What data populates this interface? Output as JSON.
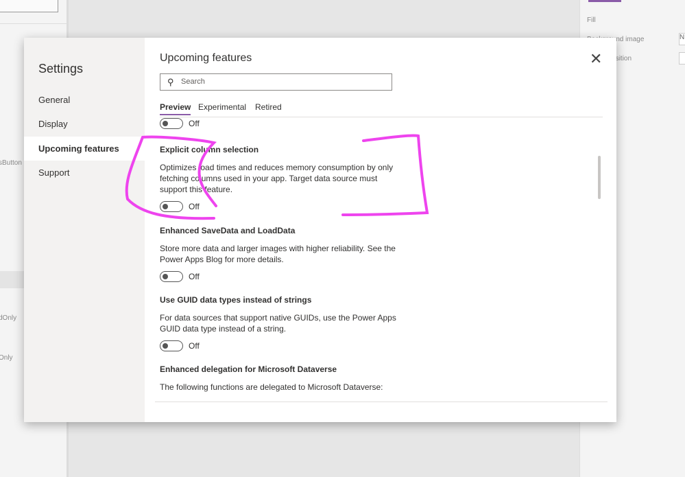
{
  "background": {
    "left_texts": [
      "sButton",
      "dOnly",
      "Only"
    ],
    "right_texts": [
      "Fill",
      "Background image",
      "Image position"
    ],
    "right_input": "N"
  },
  "dialog": {
    "nav_title": "Settings",
    "nav_items": [
      {
        "label": "General"
      },
      {
        "label": "Display"
      },
      {
        "label": "Upcoming features",
        "selected": true
      },
      {
        "label": "Support"
      }
    ],
    "title": "Upcoming features",
    "close_icon": "close-icon",
    "search_placeholder": "Search",
    "tabs": [
      {
        "label": "Preview",
        "selected": true
      },
      {
        "label": "Experimental"
      },
      {
        "label": "Retired"
      }
    ],
    "top_toggle": "Off",
    "features": [
      {
        "title": "Explicit column selection",
        "desc": "Optimizes load times and reduces memory consumption by only fetching columns used in your app. Target data source must support this feature.",
        "toggle": "Off"
      },
      {
        "title": "Enhanced SaveData and LoadData",
        "desc": "Store more data and larger images with higher reliability. See the Power Apps Blog for more details.",
        "toggle": "Off"
      },
      {
        "title": "Use GUID data types instead of strings",
        "desc": "For data sources that support native GUIDs, use the Power Apps GUID data type instead of a string.",
        "toggle": "Off"
      },
      {
        "title": "Enhanced delegation for Microsoft Dataverse",
        "desc": "The following functions are delegated to Microsoft Dataverse:"
      }
    ]
  },
  "annotation_color": "#ee44ee"
}
